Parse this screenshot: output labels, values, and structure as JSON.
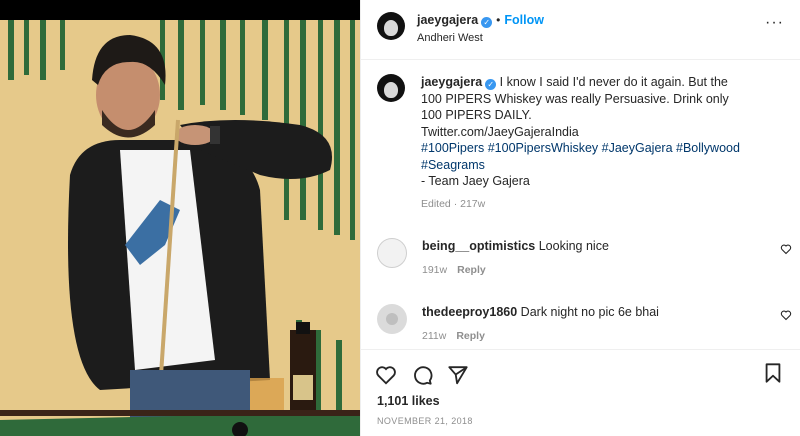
{
  "header": {
    "username": "jaeygajera",
    "follow_label": "Follow",
    "location": "Andheri West"
  },
  "caption": {
    "username": "jaeygajera",
    "line1": "I know I said I'd never do it again. But the 100 PIPERS Whiskey was really Persuasive. Drink only 100 PIPERS DAILY.",
    "line2": "Twitter.com/JaeyGajeraIndia",
    "hashtags": "#100Pipers #100PipersWhiskey #JaeyGajera #Bollywood #Seagrams",
    "signoff": "- Team Jaey Gajera",
    "edited": "Edited",
    "time": "217w"
  },
  "comments": [
    {
      "username": "being__optimistics",
      "text": "Looking nice",
      "time": "191w",
      "reply": "Reply"
    },
    {
      "username": "thedeeproy1860",
      "text": "Dark night no pic 6e bhai",
      "time": "211w",
      "reply": "Reply"
    }
  ],
  "likes": "1,101 likes",
  "date": "NOVEMBER 21, 2018",
  "icons": [
    "heart-icon",
    "comment-icon",
    "share-icon",
    "bookmark-icon",
    "more-options-icon",
    "verified-badge-icon"
  ],
  "colors": {
    "link": "#0095f6",
    "hashtag": "#00376b",
    "muted": "#8e8e8e",
    "verified": "#3897f0"
  }
}
